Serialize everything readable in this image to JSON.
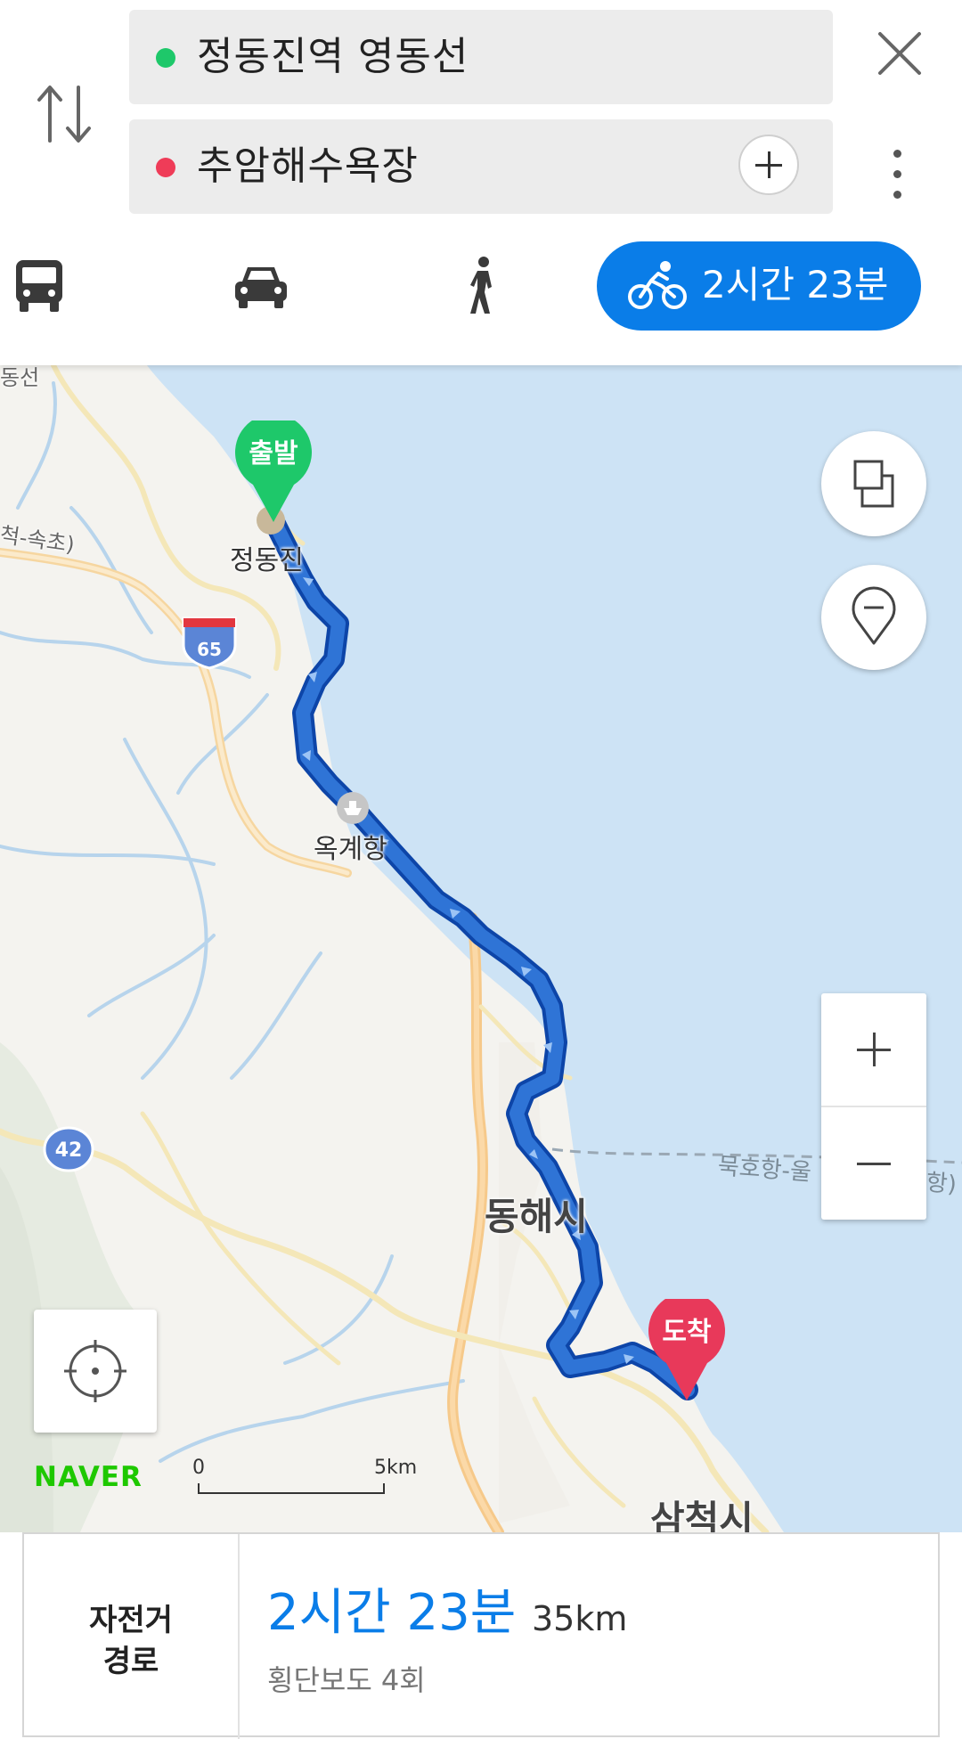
{
  "route": {
    "origin": "정동진역 영동선",
    "destination": "추암해수욕장"
  },
  "modes": {
    "bike_time": "2시간 23분"
  },
  "map": {
    "start_pin": "출발",
    "end_pin": "도착",
    "labels": {
      "jeongdongjin": "정동진",
      "okgye": "옥계항",
      "donghae": "동해시",
      "samcheok": "삼척시",
      "top_left_road": "동선",
      "road_left": "척-속초)",
      "ferry": "묵호항-울",
      "ferry_tail": "항)"
    },
    "shields": [
      "65",
      "42"
    ],
    "brand": "NAVER",
    "scale": {
      "start": "0",
      "end": "5km"
    }
  },
  "summary": {
    "type_line1": "자전거",
    "type_line2": "경로",
    "time": "2시간 23분",
    "distance": "35km",
    "crosswalks": "횡단보도 4회"
  },
  "colors": {
    "accent": "#0a7de8",
    "origin_dot": "#1ec86a",
    "destination_dot": "#ef3c58",
    "start_pin": "#1ec86a",
    "end_pin": "#e8395a",
    "route": "#1f63c9",
    "sea": "#cde3f5"
  },
  "icons": [
    "swap-icon",
    "close-icon",
    "more-icon",
    "plus-icon",
    "bus-icon",
    "car-icon",
    "walk-icon",
    "bike-icon",
    "layers-icon",
    "poi-pin-icon",
    "zoom-in-icon",
    "zoom-out-icon",
    "locate-icon"
  ]
}
